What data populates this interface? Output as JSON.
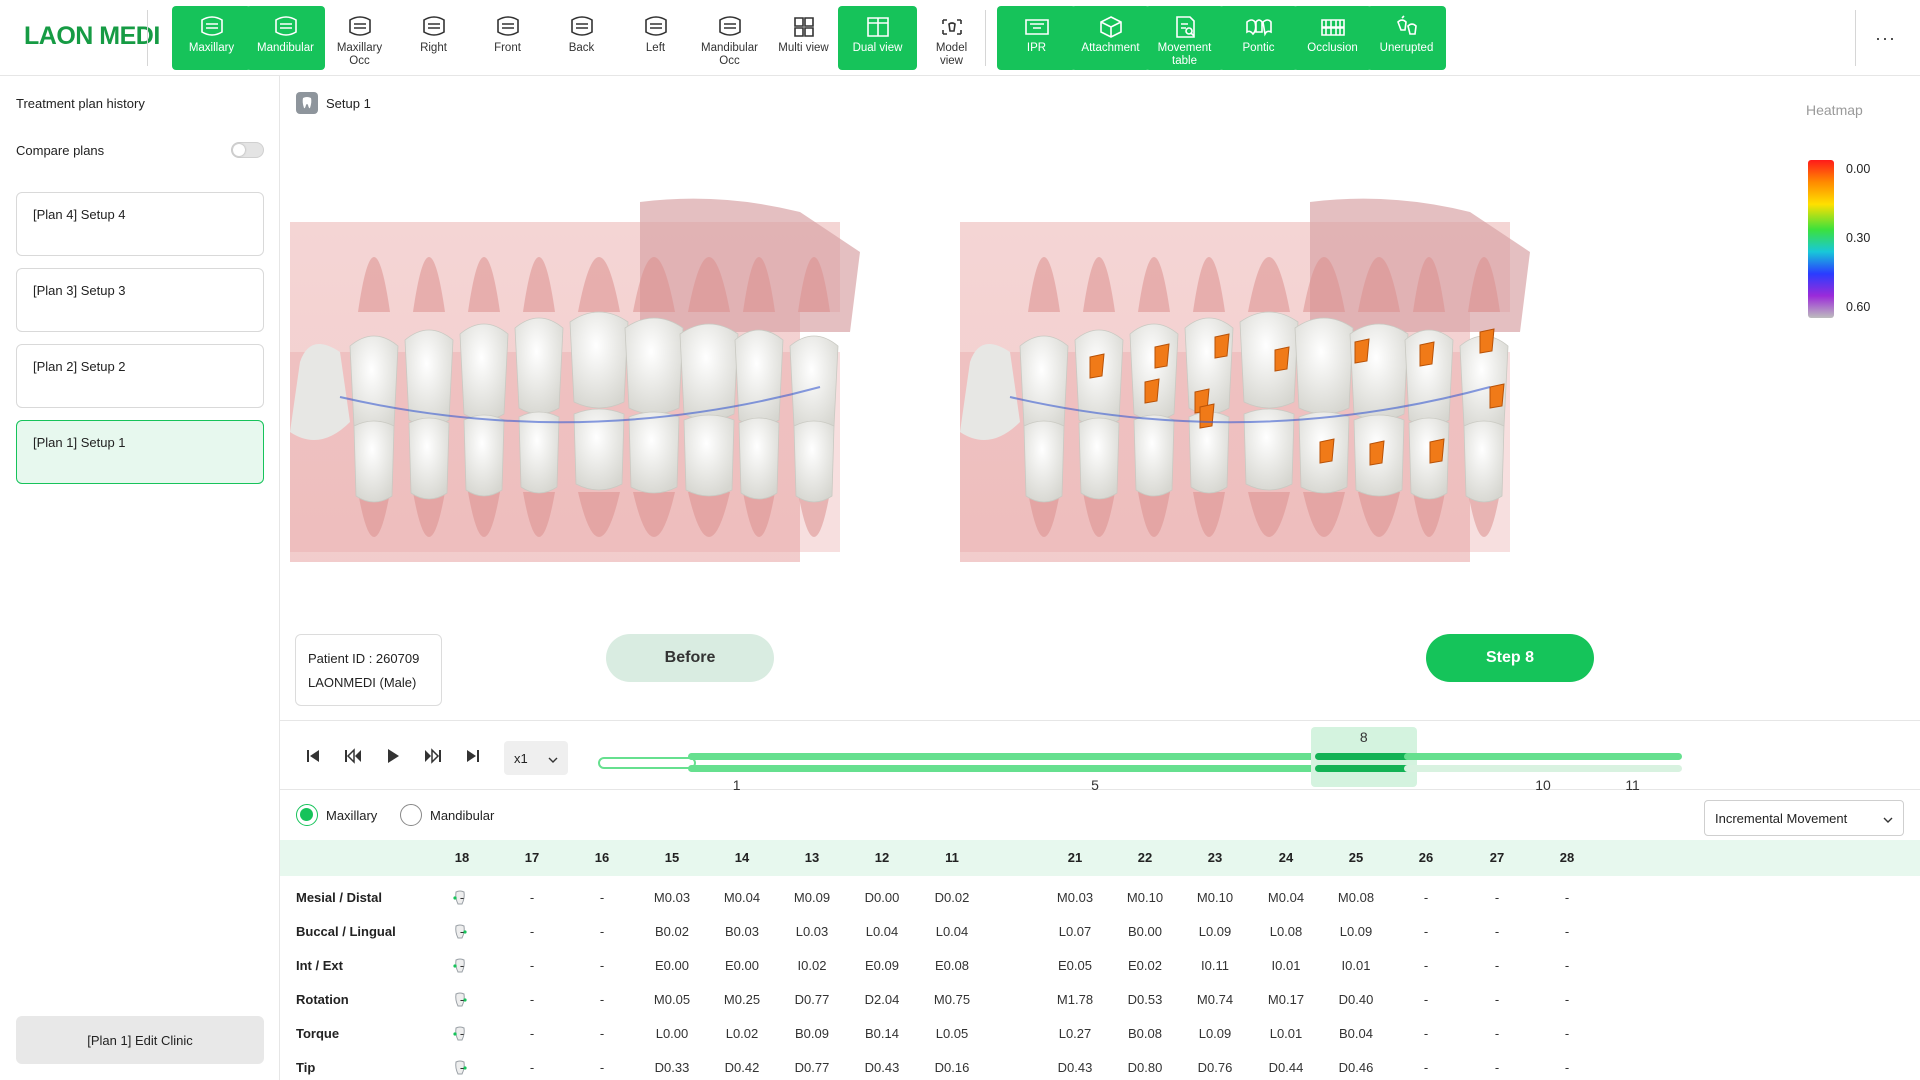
{
  "app": {
    "logo": "LAON MEDI"
  },
  "toolbar": {
    "view_tools": [
      {
        "label": "Maxillary",
        "active": true,
        "icon": "maxillary-icon"
      },
      {
        "label": "Mandibular",
        "active": true,
        "icon": "mandibular-icon"
      },
      {
        "label": "Maxillary\nOcc",
        "active": false,
        "icon": "maxillary-occ-icon"
      },
      {
        "label": "Right",
        "active": false,
        "icon": "right-view-icon"
      },
      {
        "label": "Front",
        "active": false,
        "icon": "front-view-icon"
      },
      {
        "label": "Back",
        "active": false,
        "icon": "back-view-icon"
      },
      {
        "label": "Left",
        "active": false,
        "icon": "left-view-icon"
      },
      {
        "label": "Mandibular\nOcc",
        "active": false,
        "icon": "mandibular-occ-icon"
      },
      {
        "label": "Multi view",
        "active": false,
        "icon": "multi-view-icon"
      },
      {
        "label": "Dual view",
        "active": true,
        "icon": "dual-view-icon"
      },
      {
        "label": "Model\nview",
        "active": false,
        "icon": "model-view-icon"
      }
    ],
    "analysis_tools": [
      {
        "label": "IPR",
        "icon": "ipr-icon"
      },
      {
        "label": "Attachment",
        "icon": "attachment-icon"
      },
      {
        "label": "Movement\ntable",
        "icon": "movement-table-icon"
      },
      {
        "label": "Pontic",
        "icon": "pontic-icon"
      },
      {
        "label": "Occlusion",
        "icon": "occlusion-icon"
      },
      {
        "label": "Unerupted",
        "icon": "unerupted-icon"
      }
    ],
    "more": "···"
  },
  "sidebar": {
    "title": "Treatment plan history",
    "compare_label": "Compare plans",
    "compare_on": false,
    "plans": [
      {
        "label": "[Plan 4] Setup 4",
        "selected": false
      },
      {
        "label": "[Plan 3] Setup 3",
        "selected": false
      },
      {
        "label": "[Plan 2] Setup 2",
        "selected": false
      },
      {
        "label": "[Plan 1] Setup 1",
        "selected": true
      }
    ],
    "edit_button": "[Plan 1] Edit Clinic"
  },
  "viewer": {
    "setup_label": "Setup 1",
    "patient_id": "Patient ID : 260709",
    "patient_name": "LAONMEDI (Male)",
    "left_caption": "Before",
    "right_caption": "Step 8",
    "heatmap": {
      "title": "Heatmap",
      "values": [
        "0.00",
        "0.30",
        "0.60"
      ]
    }
  },
  "playback": {
    "speed": "x1",
    "steps": [
      {
        "state": "first",
        "label": ""
      },
      {
        "state": "done",
        "label": "1"
      },
      {
        "state": "done",
        "label": ""
      },
      {
        "state": "done",
        "label": ""
      },
      {
        "state": "done",
        "label": ""
      },
      {
        "state": "done",
        "label": "5"
      },
      {
        "state": "done",
        "label": ""
      },
      {
        "state": "done",
        "label": ""
      },
      {
        "state": "current",
        "label": "8"
      },
      {
        "state": "future",
        "label": ""
      },
      {
        "state": "future",
        "label": "10"
      },
      {
        "state": "future",
        "label": "11"
      }
    ]
  },
  "table": {
    "arch_options": [
      "Maxillary",
      "Mandibular"
    ],
    "arch_selected": "Maxillary",
    "mode": "Incremental Movement",
    "teeth": [
      "18",
      "17",
      "16",
      "15",
      "14",
      "13",
      "12",
      "11",
      "21",
      "22",
      "23",
      "24",
      "25",
      "26",
      "27",
      "28"
    ],
    "rows": [
      {
        "label": "Mesial / Distal",
        "values": [
          "-",
          "-",
          "-",
          "M0.03",
          "M0.04",
          "M0.09",
          "D0.00",
          "D0.02",
          "M0.03",
          "M0.10",
          "M0.10",
          "M0.04",
          "M0.08",
          "-",
          "-",
          "-"
        ]
      },
      {
        "label": "Buccal / Lingual",
        "values": [
          "-",
          "-",
          "-",
          "B0.02",
          "B0.03",
          "L0.03",
          "L0.04",
          "L0.04",
          "L0.07",
          "B0.00",
          "L0.09",
          "L0.08",
          "L0.09",
          "-",
          "-",
          "-"
        ]
      },
      {
        "label": "Int / Ext",
        "values": [
          "-",
          "-",
          "-",
          "E0.00",
          "E0.00",
          "I0.02",
          "E0.09",
          "E0.08",
          "E0.05",
          "E0.02",
          "I0.11",
          "I0.01",
          "I0.01",
          "-",
          "-",
          "-"
        ]
      },
      {
        "label": "Rotation",
        "values": [
          "-",
          "-",
          "-",
          "M0.05",
          "M0.25",
          "D0.77",
          "D2.04",
          "M0.75",
          "M1.78",
          "D0.53",
          "M0.74",
          "M0.17",
          "D0.40",
          "-",
          "-",
          "-"
        ]
      },
      {
        "label": "Torque",
        "values": [
          "-",
          "-",
          "-",
          "L0.00",
          "L0.02",
          "B0.09",
          "B0.14",
          "L0.05",
          "L0.27",
          "B0.08",
          "L0.09",
          "L0.01",
          "B0.04",
          "-",
          "-",
          "-"
        ]
      },
      {
        "label": "Tip",
        "values": [
          "-",
          "-",
          "-",
          "D0.33",
          "D0.42",
          "D0.77",
          "D0.43",
          "D0.16",
          "D0.43",
          "D0.80",
          "D0.76",
          "D0.44",
          "D0.46",
          "-",
          "-",
          "-"
        ]
      }
    ]
  },
  "colors": {
    "accent": "#16c35a",
    "accent_light": "#e7f8ee"
  }
}
